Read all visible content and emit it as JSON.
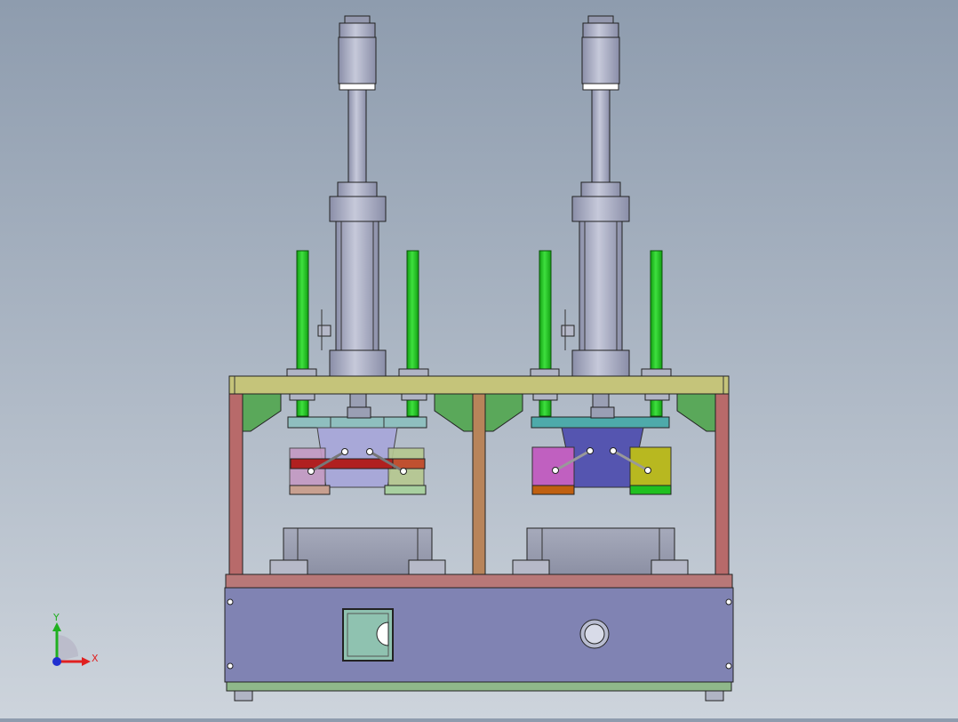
{
  "viewport": {
    "background_top": "#8e9cae",
    "background_bottom": "#cdd4dc"
  },
  "triad": {
    "x_label": "X",
    "y_label": "Y",
    "x_color": "#e02020",
    "y_color": "#20b020",
    "z_color": "#2030d0"
  },
  "model": {
    "colors": {
      "frame_top_plate": "#c5c47a",
      "frame_posts": "#b86a6a",
      "center_post": "#b8845a",
      "base_housing": "#8083b3",
      "base_top_rail": "#b87878",
      "base_bottom_rail": "#8fb88a",
      "gusset": "#5aa85a",
      "guide_rod": "#22cc22",
      "cylinder": "#a9adc2",
      "left_die_plate": "#6fa0a0",
      "right_die_plate": "#4eaaaa",
      "right_die_body": "#5555b0",
      "right_side_block_left": "#c060c0",
      "right_side_block_right": "#b8b820",
      "left_red_bar": "#b02020",
      "fixture_block": "#9a9fb0",
      "window": "#8fc2b0"
    }
  }
}
